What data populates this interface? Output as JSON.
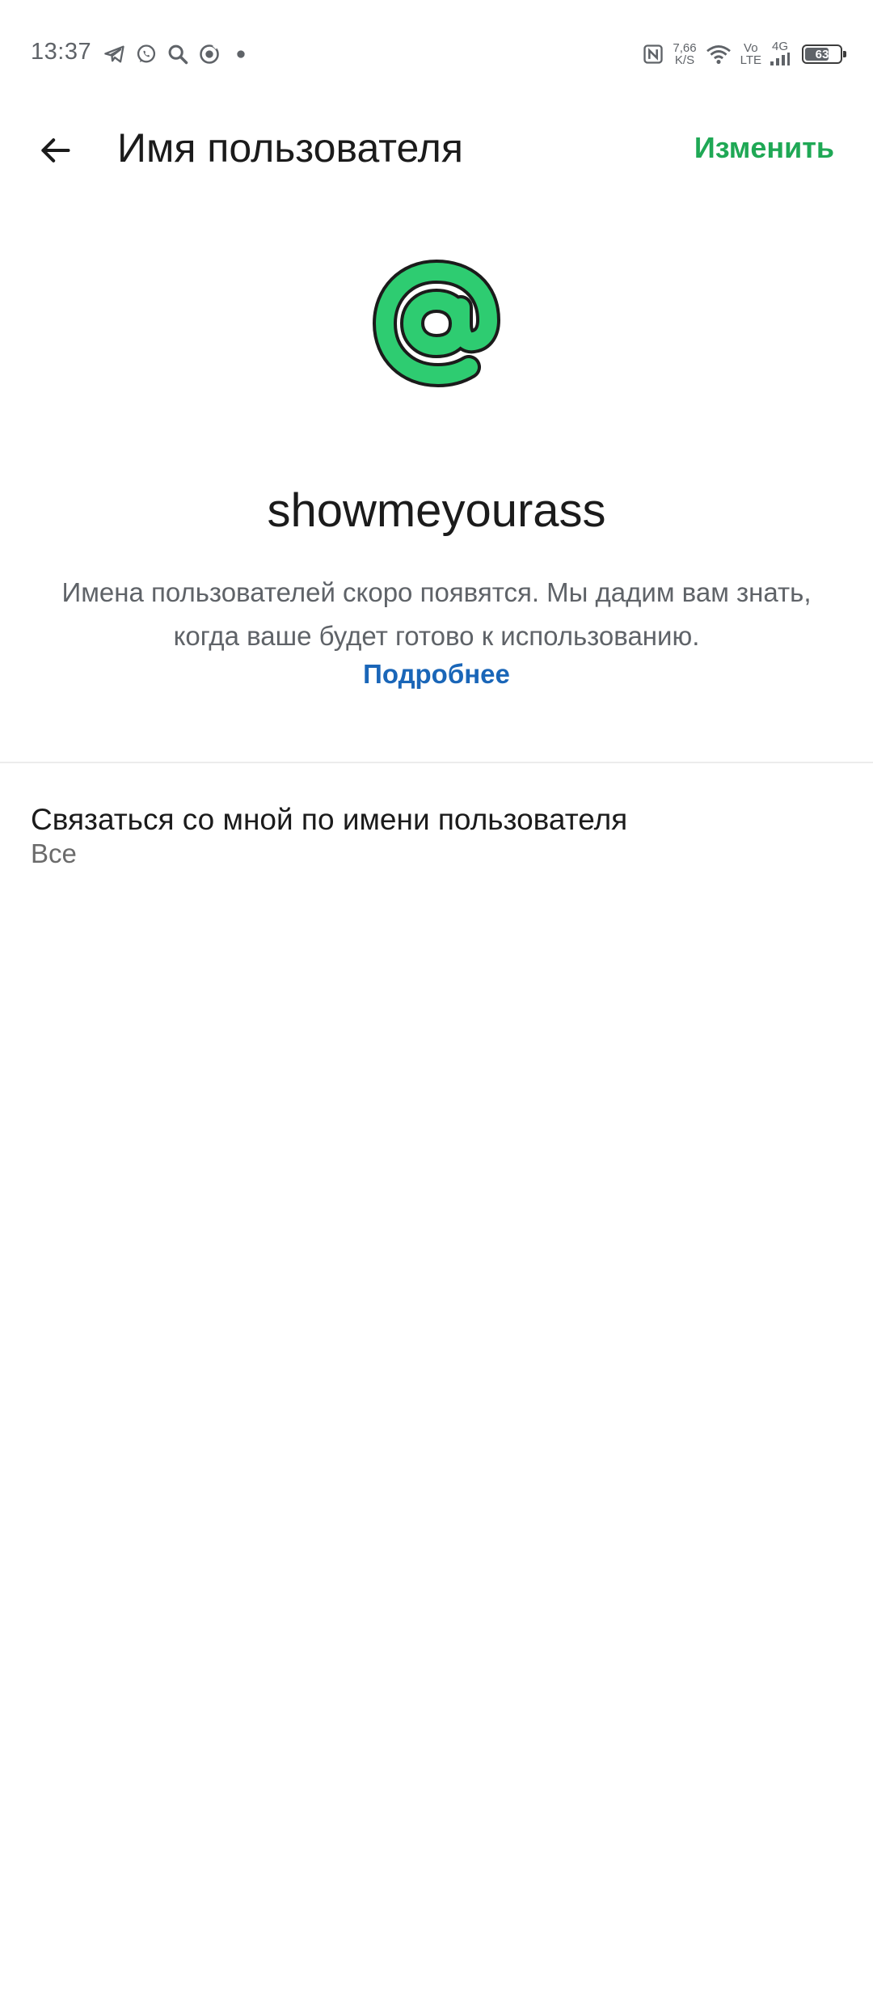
{
  "status_bar": {
    "time": "13:37",
    "net_speed_value": "7,66",
    "net_speed_unit": "K/S",
    "volte_top": "Vo",
    "volte_bottom": "LTE",
    "network_type": "4G",
    "battery_level": "63",
    "left_icons": [
      "telegram-icon",
      "whatsapp-icon",
      "search-icon",
      "app-notification-icon",
      "dot-icon"
    ],
    "right_icons": [
      "nfc-icon",
      "wifi-icon",
      "signal-icon",
      "battery-icon"
    ]
  },
  "app_bar": {
    "title": "Имя пользователя",
    "edit_label": "Изменить"
  },
  "main": {
    "username": "showmeyourass",
    "description": "Имена пользователей скоро появятся. Мы дадим вам знать, когда ваше будет готово к использованию.",
    "learn_more": "Подробнее"
  },
  "settings": {
    "contact_title": "Связаться со мной по имени пользователя",
    "contact_value": "Все"
  },
  "colors": {
    "accent_green": "#1fa855",
    "at_icon_fill": "#2ecc71",
    "link_blue": "#1a66b8",
    "secondary_text": "#5f6368"
  }
}
